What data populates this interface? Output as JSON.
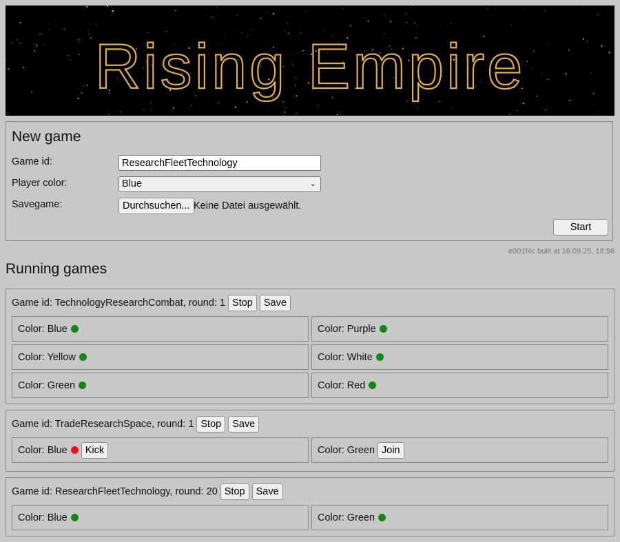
{
  "app_title": "Rising Empire",
  "new_game": {
    "heading": "New game",
    "game_id_label": "Game id:",
    "game_id_value": "ResearchFleetTechnology",
    "player_color_label": "Player color:",
    "player_color_value": "Blue",
    "savegame_label": "Savegame:",
    "browse_label": "Durchsuchen...",
    "file_status": "Keine Datei ausgewählt.",
    "start_label": "Start"
  },
  "build_info": "e001f4c built at 16.09.25, 18:56",
  "running_heading": "Running games",
  "stop_label": "Stop",
  "save_label": "Save",
  "games": [
    {
      "title": "Game id: TechnologyResearchCombat, round: 1",
      "players": [
        {
          "label": "Color: Blue",
          "status": "online"
        },
        {
          "label": "Color: Purple",
          "status": "online"
        },
        {
          "label": "Color: Yellow",
          "status": "online"
        },
        {
          "label": "Color: White",
          "status": "online"
        },
        {
          "label": "Color: Green",
          "status": "online"
        },
        {
          "label": "Color: Red",
          "status": "online"
        }
      ]
    },
    {
      "title": "Game id: TradeResearchSpace, round: 1",
      "players": [
        {
          "label": "Color: Blue",
          "status": "offline",
          "action": "Kick"
        },
        {
          "label": "Color: Green",
          "action": "Join"
        }
      ]
    },
    {
      "title": "Game id: ResearchFleetTechnology, round: 20",
      "players": [
        {
          "label": "Color: Blue",
          "status": "online"
        },
        {
          "label": "Color: Green",
          "status": "online"
        }
      ]
    }
  ],
  "colors": {
    "online": "#118811",
    "offline": "#ee1111",
    "logo": "#e0b040"
  }
}
